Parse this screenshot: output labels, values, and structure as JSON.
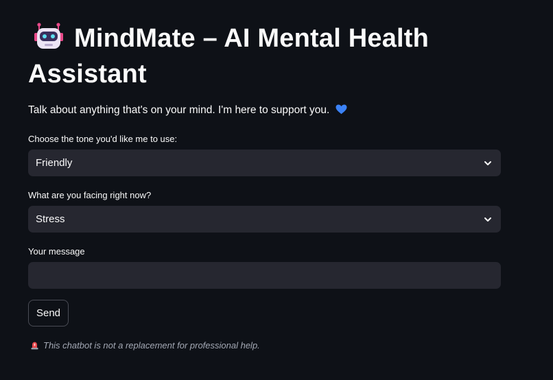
{
  "header": {
    "title": "MindMate – AI Mental Health Assistant",
    "title_icon": "robot-face-icon"
  },
  "intro": {
    "text": "Talk about anything that's on your mind. I'm here to support you.",
    "icon": "blue-heart-icon"
  },
  "tone_select": {
    "label": "Choose the tone you'd like me to use:",
    "value": "Friendly"
  },
  "issue_select": {
    "label": "What are you facing right now?",
    "value": "Stress"
  },
  "message": {
    "label": "Your message",
    "value": "",
    "placeholder": ""
  },
  "send_button": {
    "label": "Send"
  },
  "disclaimer": {
    "text": "This chatbot is not a replacement for professional help.",
    "icon": "siren-icon"
  },
  "colors": {
    "background": "#0e1117",
    "input_bg": "#262730",
    "text": "#fafafa",
    "muted": "#a3a8b4",
    "heart": "#3b82f6"
  }
}
